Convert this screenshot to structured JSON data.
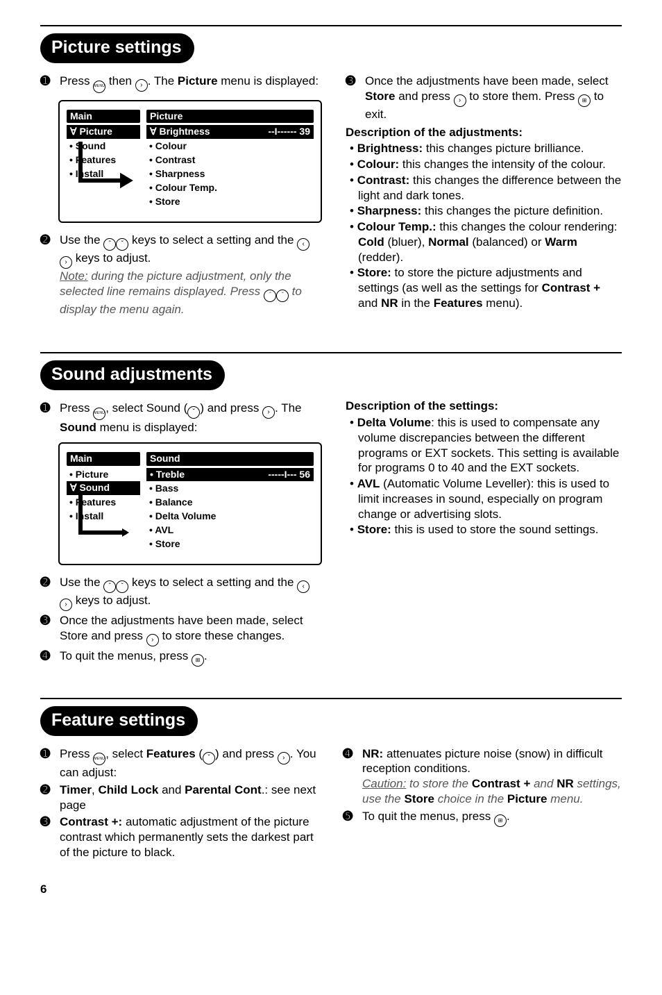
{
  "sections": {
    "picture": {
      "title": "Picture settings",
      "step1_before": "Press ",
      "step1_mid": " then ",
      "step1_after": ". The ",
      "step1_bold": "Picture",
      "step1_end": " menu is displayed:",
      "step2_before": "Use the ",
      "step2_mid": " keys to select a setting and the ",
      "step2_end": " keys to adjust.",
      "note_label": "Note:",
      "note_rest": " during the picture adjustment, only the selected line remains displayed. Press ",
      "note_tail": " to display the menu again.",
      "step3_before": "Once the adjustments have been made, select ",
      "step3_store": "Store",
      "step3_mid": " and press ",
      "step3_after": " to store them. Press ",
      "step3_end": " to exit.",
      "desc_heading": "Description of the adjustments:",
      "items": {
        "brightness": {
          "label": "Brightness:",
          "text": " this changes picture brilliance."
        },
        "colour": {
          "label": "Colour:",
          "text": " this changes the intensity of the colour."
        },
        "contrast": {
          "label": "Contrast:",
          "text": " this changes the difference between the light and dark tones."
        },
        "sharpness": {
          "label": "Sharpness:",
          "text": " this changes the picture definition."
        },
        "colourtemp": {
          "label": "Colour Temp.:",
          "text_a": " this changes the colour rendering: ",
          "cold": "Cold",
          "mid1": " (bluer), ",
          "normal": "Normal",
          "mid2": " (balanced) or ",
          "warm": "Warm",
          "tail": " (redder)."
        },
        "store": {
          "label": "Store:",
          "text_a": " to store the picture adjustments and settings (as well as the settings for ",
          "b1": "Contrast +",
          "mid": " and ",
          "b2": "NR",
          "text_b": " in the ",
          "b3": "Features",
          "tail": " menu)."
        }
      },
      "osd": {
        "left_title": "Main",
        "left_selected": "Ɐ Picture",
        "left_items": [
          "• Sound",
          "• Features",
          "• Install"
        ],
        "right_title": "Picture",
        "right_selected_label": "Ɐ Brightness",
        "right_selected_value": "--I------  39",
        "right_items": [
          "• Colour",
          "• Contrast",
          "• Sharpness",
          "• Colour Temp.",
          "• Store"
        ]
      }
    },
    "sound": {
      "title": "Sound adjustments",
      "step1_before": "Press ",
      "step1_mid": ", select Sound (",
      "step1_mid2": ") and press ",
      "step1_after": ". The ",
      "step1_bold": "Sound",
      "step1_end": " menu is displayed:",
      "step2_before": "Use the ",
      "step2_mid": " keys to select a setting and the ",
      "step2_end": " keys to adjust.",
      "step3_before": "Once the adjustments have been made, select Store and press ",
      "step3_end": " to store these changes.",
      "step4_before": "To quit the menus, press ",
      "step4_end": ".",
      "desc_heading": "Description of the settings:",
      "items": {
        "dv": {
          "label": "Delta Volume",
          "text": ": this is used to compensate any volume discrepancies between the different programs or EXT sockets. This setting is available for programs 0 to 40 and the EXT sockets."
        },
        "avl": {
          "label": "AVL",
          "paren": " (Automatic Volume Leveller): this is used to limit increases in sound, especially on program change or advertising slots."
        },
        "store": {
          "label": "Store:",
          "text": " this is used to store the sound settings."
        }
      },
      "osd": {
        "left_title": "Main",
        "left_items_before": [
          "• Picture"
        ],
        "left_selected": "Ɐ Sound",
        "left_items_after": [
          "• Features",
          "• Install"
        ],
        "right_title": "Sound",
        "right_selected_label": "• Treble",
        "right_selected_value": "-----I---  56",
        "right_items": [
          "• Bass",
          "• Balance",
          "• Delta Volume",
          "• AVL",
          "• Store"
        ]
      }
    },
    "features": {
      "title": "Feature settings",
      "step1_before": "Press ",
      "step1_mid": ", select ",
      "feat_bold": "Features",
      "step1_mid2": " (",
      "step1_mid3": ") and press ",
      "step1_after": ". You can adjust:",
      "step2_a": "Timer",
      "step2_sep1": ", ",
      "step2_b": "Child Lock",
      "step2_sep2": " and ",
      "step2_c": "Parental Cont",
      "step2_tail": ".: see next page",
      "step3_label": "Contrast +:",
      "step3_text": " automatic adjustment of the picture contrast which permanently sets the darkest part of the picture to black.",
      "step4_label": "NR:",
      "step4_text": " attenuates picture noise (snow) in difficult reception conditions.",
      "caution_label": "Caution:",
      "caution_a": " to store the ",
      "caution_b1": "Contrast +",
      "caution_mid": " and ",
      "caution_b2": "NR",
      "caution_c": " settings, use the ",
      "caution_b3": "Store",
      "caution_d": " choice in the ",
      "caution_b4": "Picture",
      "caution_tail": " menu.",
      "step5_before": "To quit the menus, press ",
      "step5_end": "."
    }
  },
  "icons": {
    "menu": "MENU",
    "right": "›",
    "left": "‹",
    "up": "ˆ",
    "down": "ˇ",
    "tv": "⊞"
  },
  "page_number": "6"
}
